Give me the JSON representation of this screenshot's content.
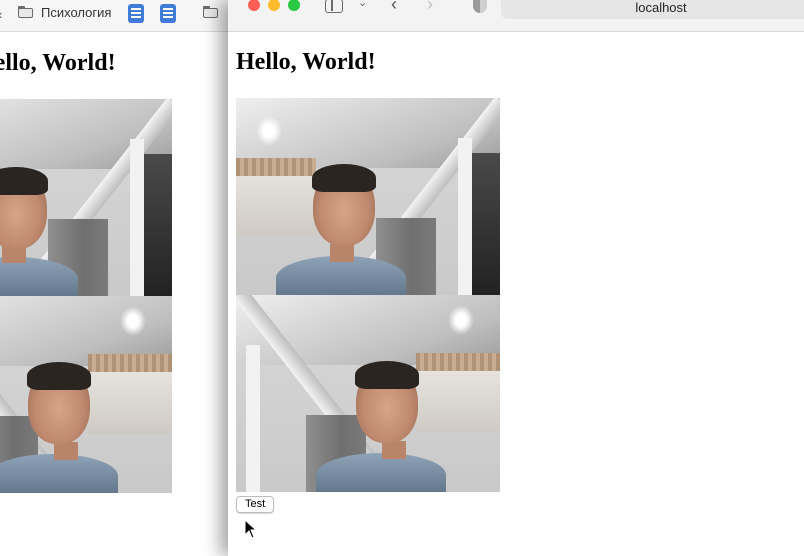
{
  "left_window": {
    "bookmarks_bar": {
      "items": [
        {
          "label": "Психология",
          "icon": "folder-icon"
        },
        {
          "label": "",
          "icon": "doc-icon"
        },
        {
          "label": "",
          "icon": "doc-icon"
        },
        {
          "label": "",
          "icon": "folder-icon"
        }
      ]
    },
    "heading": "Hello, World!"
  },
  "right_window": {
    "toolbar": {
      "traffic_lights": {
        "close": "#ff5f57",
        "minimize": "#febc2e",
        "zoom": "#28c840"
      },
      "icons": [
        "sidebar-toggle-icon",
        "chevron-down-icon",
        "back-chevron-icon",
        "forward-chevron-icon",
        "shield-icon"
      ],
      "address": "localhost"
    },
    "page": {
      "heading": "Hello, World!",
      "button_label": "Test"
    }
  }
}
